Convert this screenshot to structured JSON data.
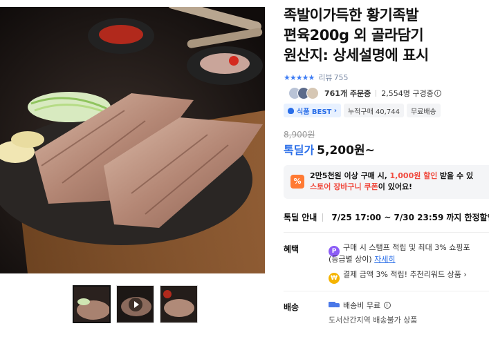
{
  "product": {
    "title_lines": [
      "족발이가득한 황기족발",
      "편육200g 외 골라담기",
      "원산지: 상세설명에 표시"
    ],
    "rating_stars": 5,
    "review_label": "리뷰",
    "review_count": "755",
    "order_count": "761개 주문중",
    "wishlist_count": "2,554명 구경중",
    "tags": [
      "식품 BEST",
      "누적구매 40,744",
      "무료배송"
    ],
    "original_price": "8,900원",
    "deal_label": "톡딜가",
    "price": "5,200원~"
  },
  "coupon": {
    "icon": "%",
    "line1_prefix": "2만5천원 이상 구매 시,",
    "line1_amount": "1,000원 할인",
    "line1_suffix": "받을 수 있",
    "line2_red": "스토어 장바구니 쿠폰",
    "line2_suffix": "이 있어요!"
  },
  "deal_info": {
    "label": "톡딜 안내",
    "period": "7/25 17:00 ~ 7/30 23:59",
    "suffix": "까지 한정할인"
  },
  "benefits": {
    "label": "혜택",
    "item1_icon": "P",
    "item1_line1": "구매 시 스탬프 적립 및 최대 3% 쇼핑포",
    "item1_line2_prefix": "(등급별 상이)",
    "item1_link": "자세히",
    "item2_icon": "₩",
    "item2_text": "결제 금액 3% 적립! 추천리워드 상품",
    "item2_chevron": "›"
  },
  "shipping": {
    "label": "배송",
    "fee": "배송비 무료",
    "note": "도서산간지역 배송불가 상품"
  },
  "colors": {
    "accent": "#2a6ee8",
    "coupon": "#ff7a33",
    "highlight_red": "#f04a3e",
    "point_icon": "#8b5cf6",
    "won_icon": "#f5b400"
  }
}
